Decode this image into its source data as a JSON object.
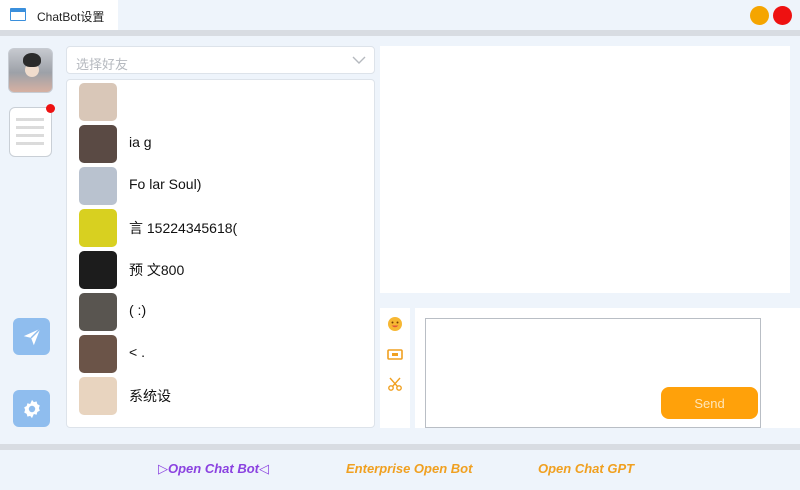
{
  "window": {
    "title": "ChatBot设置"
  },
  "friends": {
    "search_placeholder": "选择好友",
    "items": [
      {
        "name": "",
        "color": "#d9c7b8"
      },
      {
        "name": "ia g",
        "color": "#5a4a44"
      },
      {
        "name": "Fo    lar    Soul)",
        "color": "#b9c2cf"
      },
      {
        "name": "言              15224345618(",
        "color": "#d8d020"
      },
      {
        "name": "                预   文800",
        "color": "#1c1c1c"
      },
      {
        "name": "              ( :)",
        "color": "#595550"
      },
      {
        "name": "<              .",
        "color": "#6b5448"
      },
      {
        "name": "                         系统设",
        "color": "#e8d4bf"
      }
    ]
  },
  "composer": {
    "send_label": "Send"
  },
  "footer": {
    "link1": "▷Open Chat Bot◁",
    "link2": "Enterprise Open Bot",
    "link3": "Open Chat GPT"
  },
  "colors": {
    "accent": "#ffa10a",
    "rail_button": "#8fbdee",
    "close": "#ee1111",
    "minimize": "#f5a500",
    "purple_link": "#8b42e0"
  }
}
